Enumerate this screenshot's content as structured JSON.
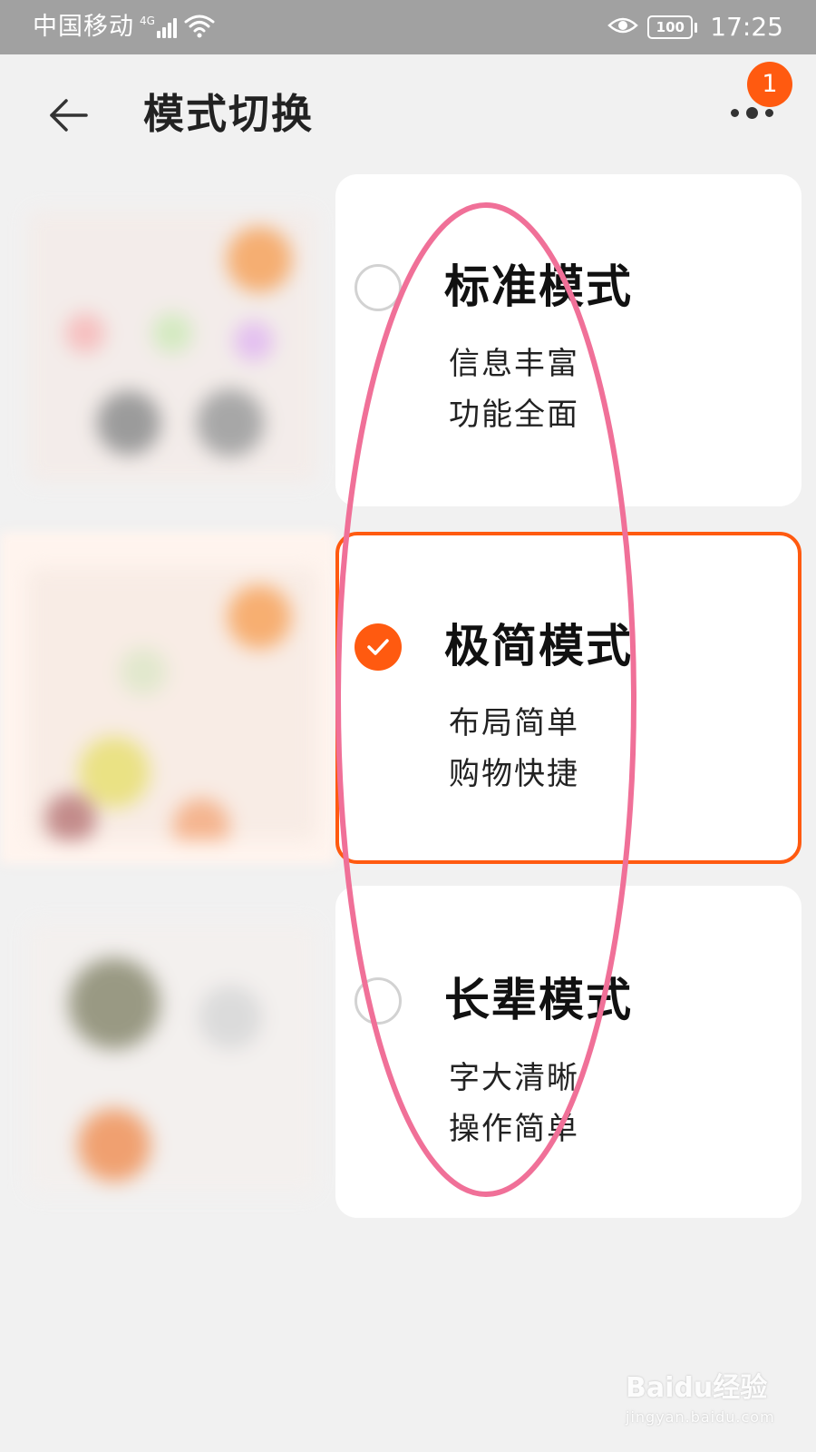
{
  "status_bar": {
    "carrier": "中国移动",
    "network": "4G",
    "battery": "100",
    "time": "17:25"
  },
  "header": {
    "title": "模式切换",
    "back_icon": "arrow-left-icon",
    "more_icon": "more-dots-icon",
    "badge_count": "1"
  },
  "modes": [
    {
      "name": "标准模式",
      "line1": "信息丰富",
      "line2": "功能全面",
      "selected": false
    },
    {
      "name": "极简模式",
      "line1": "布局简单",
      "line2": "购物快捷",
      "selected": true
    },
    {
      "name": "长辈模式",
      "line1": "字大清晰",
      "line2": "操作简单",
      "selected": false
    }
  ],
  "colors": {
    "accent": "#ff5a10",
    "annotation": "#f07098",
    "status_bar": "#a1a1a1",
    "background": "#f1f1f1"
  },
  "watermark": {
    "brand": "Baidu经验",
    "url": "jingyan.baidu.com"
  }
}
